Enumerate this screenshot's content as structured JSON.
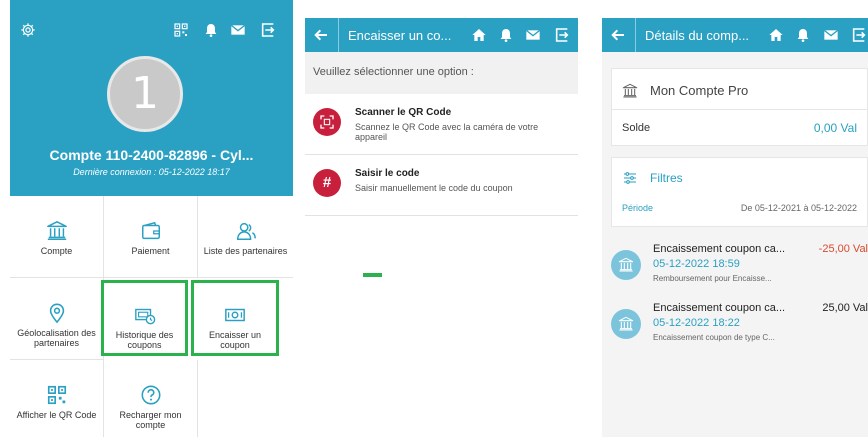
{
  "colors": {
    "primary": "#2aa0c3",
    "highlight": "#2bb24c",
    "option_icon": "#c8203c",
    "negative": "#d64a2e"
  },
  "home": {
    "avatar_initial": "1",
    "account_title": "Compte 110-2400-82896 - Cyl...",
    "last_login": "Dernière connexion : 05-12-2022 18:17",
    "tiles": [
      {
        "label": "Compte",
        "icon": "bank-icon"
      },
      {
        "label": "Paiement",
        "icon": "wallet-icon"
      },
      {
        "label": "Liste des partenaires",
        "icon": "partners-icon"
      },
      {
        "label": "Géolocalisation des partenaires",
        "icon": "location-pin-icon"
      },
      {
        "label": "Historique des coupons",
        "icon": "coupon-history-icon"
      },
      {
        "label": "Encaisser un coupon",
        "icon": "cash-coupon-icon"
      },
      {
        "label": "Afficher le QR Code",
        "icon": "qr-code-icon"
      },
      {
        "label": "Recharger mon compte",
        "icon": "help-circle-icon"
      }
    ]
  },
  "cash": {
    "title": "Encaisser un co...",
    "prompt": "Veuillez sélectionner une option :",
    "options": [
      {
        "title": "Scanner le QR Code",
        "desc": "Scannez le QR Code avec la caméra de votre appareil",
        "icon": "qr-scan-icon"
      },
      {
        "title": "Saisir le code",
        "desc": "Saisir manuellement le code du coupon",
        "icon": "hash-icon",
        "glyph": "#"
      }
    ]
  },
  "details": {
    "title": "Détails du comp...",
    "account_name": "Mon Compte Pro",
    "balance_label": "Solde",
    "balance_value": "0,00 Val",
    "filters_label": "Filtres",
    "period_label": "Période",
    "period_value": "De 05-12-2021 à 05-12-2022",
    "transactions": [
      {
        "title": "Encaissement coupon ca...",
        "amount": "-25,00 Val",
        "date": "05-12-2022 18:59",
        "note": "Remboursement pour Encaisse...",
        "negative": true
      },
      {
        "title": "Encaissement coupon ca...",
        "amount": "25,00 Val",
        "date": "05-12-2022 18:22",
        "note": "Encaissement coupon de type C...",
        "negative": false
      }
    ]
  }
}
